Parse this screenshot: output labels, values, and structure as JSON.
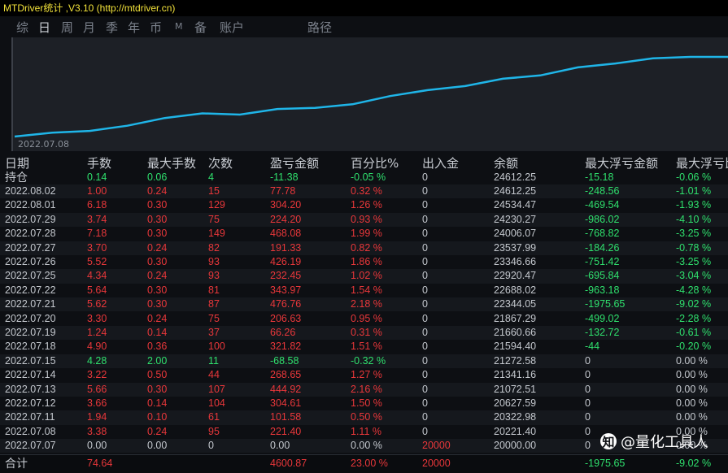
{
  "app": {
    "title": "MTDriver统计 ,V3.10 (http://mtdriver.cn)"
  },
  "tabs": [
    {
      "label": "综",
      "active": false
    },
    {
      "label": "日",
      "active": true
    },
    {
      "label": "周",
      "active": false
    },
    {
      "label": "月",
      "active": false
    },
    {
      "label": "季",
      "active": false
    },
    {
      "label": "年",
      "active": false
    },
    {
      "label": "币",
      "active": false
    },
    {
      "label": "M",
      "active": false
    },
    {
      "label": "备",
      "active": false
    },
    {
      "label": "账户",
      "active": false
    },
    {
      "label": "路径",
      "active": false
    }
  ],
  "chart_data": {
    "type": "line",
    "x_start_label": "2022.07.08",
    "series": [
      {
        "values": [
          20000,
          20221,
          20323,
          20628,
          21073,
          21341,
          21273,
          21594,
          21661,
          21867,
          22344,
          22688,
          22921,
          23347,
          23538,
          24006,
          24230,
          24534,
          24612,
          24612
        ]
      }
    ],
    "color": "#1fb5e8"
  },
  "table": {
    "headers": [
      "日期",
      "手数",
      "最大手数",
      "次数",
      "盈亏金额",
      "百分比%",
      "出入金",
      "余额",
      "最大浮亏金额",
      "最大浮亏比"
    ],
    "rows": [
      {
        "cells": [
          "持仓",
          "0.14",
          "0.06",
          "4",
          "-11.38",
          "-0.05 %",
          "0",
          "24612.25",
          "-15.18",
          "-0.06 %"
        ],
        "colors": [
          "w",
          "g",
          "g",
          "g",
          "g",
          "g",
          "w",
          "w",
          "g",
          "g"
        ]
      },
      {
        "cells": [
          "2022.08.02",
          "1.00",
          "0.24",
          "15",
          "77.78",
          "0.32 %",
          "0",
          "24612.25",
          "-248.56",
          "-1.01 %"
        ],
        "colors": [
          "w",
          "r",
          "r",
          "r",
          "r",
          "r",
          "w",
          "w",
          "g",
          "g"
        ]
      },
      {
        "cells": [
          "2022.08.01",
          "6.18",
          "0.30",
          "129",
          "304.20",
          "1.26 %",
          "0",
          "24534.47",
          "-469.54",
          "-1.93 %"
        ],
        "colors": [
          "w",
          "r",
          "r",
          "r",
          "r",
          "r",
          "w",
          "w",
          "g",
          "g"
        ]
      },
      {
        "cells": [
          "2022.07.29",
          "3.74",
          "0.30",
          "75",
          "224.20",
          "0.93 %",
          "0",
          "24230.27",
          "-986.02",
          "-4.10 %"
        ],
        "colors": [
          "w",
          "r",
          "r",
          "r",
          "r",
          "r",
          "w",
          "w",
          "g",
          "g"
        ]
      },
      {
        "cells": [
          "2022.07.28",
          "7.18",
          "0.30",
          "149",
          "468.08",
          "1.99 %",
          "0",
          "24006.07",
          "-768.82",
          "-3.25 %"
        ],
        "colors": [
          "w",
          "r",
          "r",
          "r",
          "r",
          "r",
          "w",
          "w",
          "g",
          "g"
        ]
      },
      {
        "cells": [
          "2022.07.27",
          "3.70",
          "0.24",
          "82",
          "191.33",
          "0.82 %",
          "0",
          "23537.99",
          "-184.26",
          "-0.78 %"
        ],
        "colors": [
          "w",
          "r",
          "r",
          "r",
          "r",
          "r",
          "w",
          "w",
          "g",
          "g"
        ]
      },
      {
        "cells": [
          "2022.07.26",
          "5.52",
          "0.30",
          "93",
          "426.19",
          "1.86 %",
          "0",
          "23346.66",
          "-751.42",
          "-3.25 %"
        ],
        "colors": [
          "w",
          "r",
          "r",
          "r",
          "r",
          "r",
          "w",
          "w",
          "g",
          "g"
        ]
      },
      {
        "cells": [
          "2022.07.25",
          "4.34",
          "0.24",
          "93",
          "232.45",
          "1.02 %",
          "0",
          "22920.47",
          "-695.84",
          "-3.04 %"
        ],
        "colors": [
          "w",
          "r",
          "r",
          "r",
          "r",
          "r",
          "w",
          "w",
          "g",
          "g"
        ]
      },
      {
        "cells": [
          "2022.07.22",
          "5.64",
          "0.30",
          "81",
          "343.97",
          "1.54 %",
          "0",
          "22688.02",
          "-963.18",
          "-4.28 %"
        ],
        "colors": [
          "w",
          "r",
          "r",
          "r",
          "r",
          "r",
          "w",
          "w",
          "g",
          "g"
        ]
      },
      {
        "cells": [
          "2022.07.21",
          "5.62",
          "0.30",
          "87",
          "476.76",
          "2.18 %",
          "0",
          "22344.05",
          "-1975.65",
          "-9.02 %"
        ],
        "colors": [
          "w",
          "r",
          "r",
          "r",
          "r",
          "r",
          "w",
          "w",
          "g",
          "g"
        ]
      },
      {
        "cells": [
          "2022.07.20",
          "3.30",
          "0.24",
          "75",
          "206.63",
          "0.95 %",
          "0",
          "21867.29",
          "-499.02",
          "-2.28 %"
        ],
        "colors": [
          "w",
          "r",
          "r",
          "r",
          "r",
          "r",
          "w",
          "w",
          "g",
          "g"
        ]
      },
      {
        "cells": [
          "2022.07.19",
          "1.24",
          "0.14",
          "37",
          "66.26",
          "0.31 %",
          "0",
          "21660.66",
          "-132.72",
          "-0.61 %"
        ],
        "colors": [
          "w",
          "r",
          "r",
          "r",
          "r",
          "r",
          "w",
          "w",
          "g",
          "g"
        ]
      },
      {
        "cells": [
          "2022.07.18",
          "4.90",
          "0.36",
          "100",
          "321.82",
          "1.51 %",
          "0",
          "21594.40",
          "-44",
          "-0.20 %"
        ],
        "colors": [
          "w",
          "r",
          "r",
          "r",
          "r",
          "r",
          "w",
          "w",
          "g",
          "g"
        ]
      },
      {
        "cells": [
          "2022.07.15",
          "4.28",
          "2.00",
          "11",
          "-68.58",
          "-0.32 %",
          "0",
          "21272.58",
          "0",
          "0.00 %"
        ],
        "colors": [
          "w",
          "g",
          "g",
          "g",
          "g",
          "g",
          "w",
          "w",
          "w",
          "w"
        ]
      },
      {
        "cells": [
          "2022.07.14",
          "3.22",
          "0.50",
          "44",
          "268.65",
          "1.27 %",
          "0",
          "21341.16",
          "0",
          "0.00 %"
        ],
        "colors": [
          "w",
          "r",
          "r",
          "r",
          "r",
          "r",
          "w",
          "w",
          "w",
          "w"
        ]
      },
      {
        "cells": [
          "2022.07.13",
          "5.66",
          "0.30",
          "107",
          "444.92",
          "2.16 %",
          "0",
          "21072.51",
          "0",
          "0.00 %"
        ],
        "colors": [
          "w",
          "r",
          "r",
          "r",
          "r",
          "r",
          "w",
          "w",
          "w",
          "w"
        ]
      },
      {
        "cells": [
          "2022.07.12",
          "3.66",
          "0.14",
          "104",
          "304.61",
          "1.50 %",
          "0",
          "20627.59",
          "0",
          "0.00 %"
        ],
        "colors": [
          "w",
          "r",
          "r",
          "r",
          "r",
          "r",
          "w",
          "w",
          "w",
          "w"
        ]
      },
      {
        "cells": [
          "2022.07.11",
          "1.94",
          "0.10",
          "61",
          "101.58",
          "0.50 %",
          "0",
          "20322.98",
          "0",
          "0.00 %"
        ],
        "colors": [
          "w",
          "r",
          "r",
          "r",
          "r",
          "r",
          "w",
          "w",
          "w",
          "w"
        ]
      },
      {
        "cells": [
          "2022.07.08",
          "3.38",
          "0.24",
          "95",
          "221.40",
          "1.11 %",
          "0",
          "20221.40",
          "0",
          "0.00 %"
        ],
        "colors": [
          "w",
          "r",
          "r",
          "r",
          "r",
          "r",
          "w",
          "w",
          "w",
          "w"
        ]
      },
      {
        "cells": [
          "2022.07.07",
          "0.00",
          "0.00",
          "0",
          "0.00",
          "0.00 %",
          "20000",
          "20000.00",
          "0",
          "0.00 %"
        ],
        "colors": [
          "w",
          "w",
          "w",
          "w",
          "w",
          "w",
          "r",
          "w",
          "w",
          "w"
        ]
      }
    ],
    "footer": {
      "cells": [
        "合计",
        "74.64",
        "",
        "",
        "4600.87",
        "23.00 %",
        "20000",
        "",
        "-1975.65",
        "-9.02 %"
      ],
      "colors": [
        "w",
        "r",
        "w",
        "w",
        "r",
        "r",
        "r",
        "w",
        "g",
        "g"
      ]
    }
  },
  "watermark": {
    "label": "@量化工具人",
    "icon": "zhihu-logo-icon"
  }
}
